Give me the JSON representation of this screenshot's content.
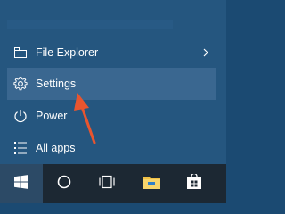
{
  "start_menu": {
    "items": [
      {
        "label": "File Explorer",
        "icon": "file-explorer-icon",
        "has_submenu": true
      },
      {
        "label": "Settings",
        "icon": "settings-gear-icon",
        "highlighted": true
      },
      {
        "label": "Power",
        "icon": "power-icon"
      },
      {
        "label": "All apps",
        "icon": "all-apps-icon"
      }
    ]
  },
  "taskbar": {
    "buttons": [
      {
        "icon": "windows-start-icon"
      },
      {
        "icon": "search-cortana-icon"
      },
      {
        "icon": "task-view-icon"
      },
      {
        "icon": "file-explorer-folder-icon"
      },
      {
        "icon": "store-icon"
      }
    ]
  },
  "colors": {
    "menu_bg": "#25567f",
    "highlight_bg": "#3a6790",
    "taskbar_bg": "#1c2833",
    "annotation_arrow": "#e8552f"
  }
}
